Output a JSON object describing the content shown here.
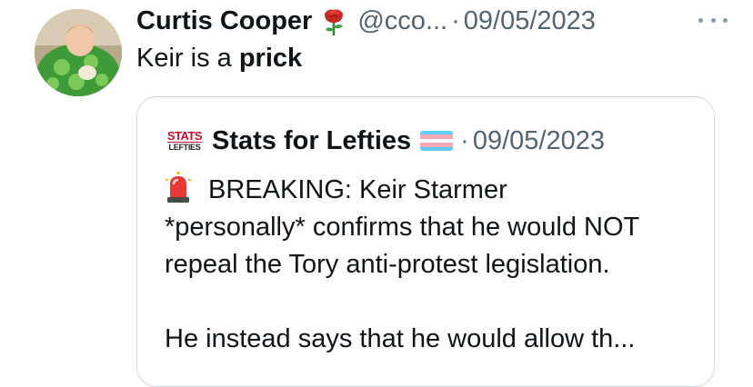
{
  "author": {
    "avatar_icon": "avatar-image",
    "display_name": "Curtis Cooper",
    "badge_icon": "rose-emoji",
    "handle": "@cco...",
    "separator": "·",
    "date": "09/05/2023"
  },
  "tweet": {
    "text_prefix": "Keir is a ",
    "text_bold": "prick"
  },
  "quoted": {
    "logo_line1": "STATS",
    "logo_line2": "LEFTIES",
    "display_name": "Stats for Lefties",
    "flag_icon": "transgender-flag-emoji",
    "separator": "·",
    "date": "09/05/2023",
    "siren_icon": "police-siren-emoji",
    "lines": [
      "BREAKING: Keir Starmer",
      "*personally* confirms that he would NOT",
      "repeal the Tory anti-protest legislation.",
      "",
      "He instead says that he would allow th..."
    ]
  },
  "colors": {
    "text": "#0f1419",
    "secondary": "#536471",
    "border": "#cfd9de",
    "flag_blue": "#5bcefa",
    "flag_pink": "#f5a9b8",
    "flag_white": "#ffffff"
  }
}
